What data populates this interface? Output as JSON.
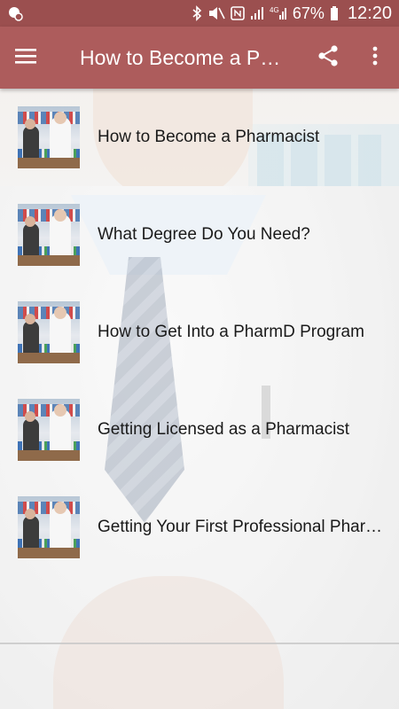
{
  "status_bar": {
    "battery_percent": "67%",
    "time": "12:20",
    "network": "4G",
    "icons": [
      "notification-icon",
      "bluetooth-icon",
      "mute-icon",
      "nfc-icon",
      "signal-icon",
      "lte-icon",
      "battery-icon"
    ]
  },
  "app_bar": {
    "title": "How to Become a Pharmacist",
    "menu_icon": "hamburger-menu-icon",
    "share_icon": "share-icon",
    "more_icon": "more-vert-icon"
  },
  "list": {
    "items": [
      {
        "label": "How to Become a Pharmacist"
      },
      {
        "label": "What Degree Do You Need?"
      },
      {
        "label": "How to Get Into a PharmD Program"
      },
      {
        "label": "Getting Licensed as a Pharmacist"
      },
      {
        "label": "Getting Your First Professional Pharmacist Job"
      }
    ]
  },
  "colors": {
    "status_bar": "#9b4f4f",
    "app_bar": "#ad5c5c",
    "text": "#1a1a1a"
  }
}
